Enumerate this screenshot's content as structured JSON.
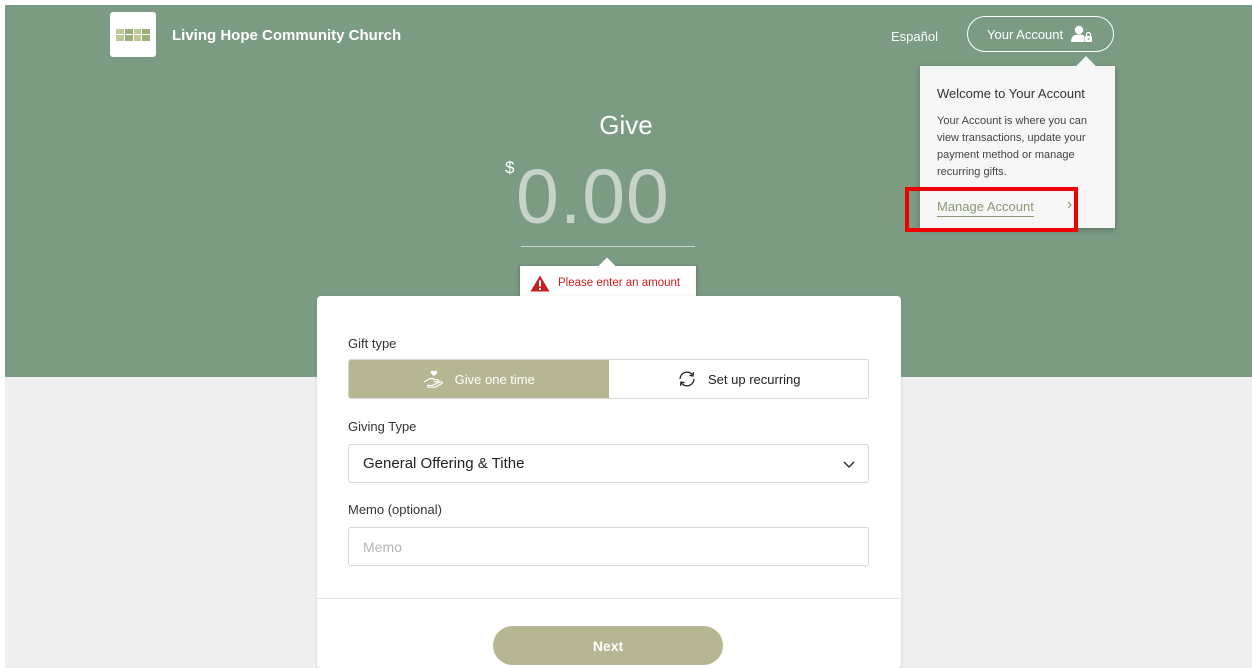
{
  "header": {
    "church_name": "Living Hope Community Church",
    "language_link": "Español",
    "account_button_label": "Your Account"
  },
  "account_popover": {
    "title": "Welcome to Your Account",
    "body": "Your Account is where you can view transactions, update your payment method or manage recurring gifts.",
    "manage_link": "Manage Account",
    "chevron": "›"
  },
  "amount": {
    "title": "Give",
    "currency_symbol": "$",
    "value": "0.00",
    "error_message": "Please enter an amount"
  },
  "form": {
    "gift_type_label": "Gift type",
    "gift_type_options": [
      {
        "label": "Give one time",
        "icon": "hand-heart-icon",
        "selected": true
      },
      {
        "label": "Set up recurring",
        "icon": "recurring-icon",
        "selected": false
      }
    ],
    "giving_type_label": "Giving Type",
    "giving_type_selected": "General Offering & Tithe",
    "memo_label": "Memo (optional)",
    "memo_placeholder": "Memo",
    "memo_value": "",
    "next_button": "Next"
  },
  "colors": {
    "hero_green": "#7c9b83",
    "accent_olive": "#b6b693",
    "error_red": "#cc1f1f",
    "highlight_red": "#ee0000"
  }
}
